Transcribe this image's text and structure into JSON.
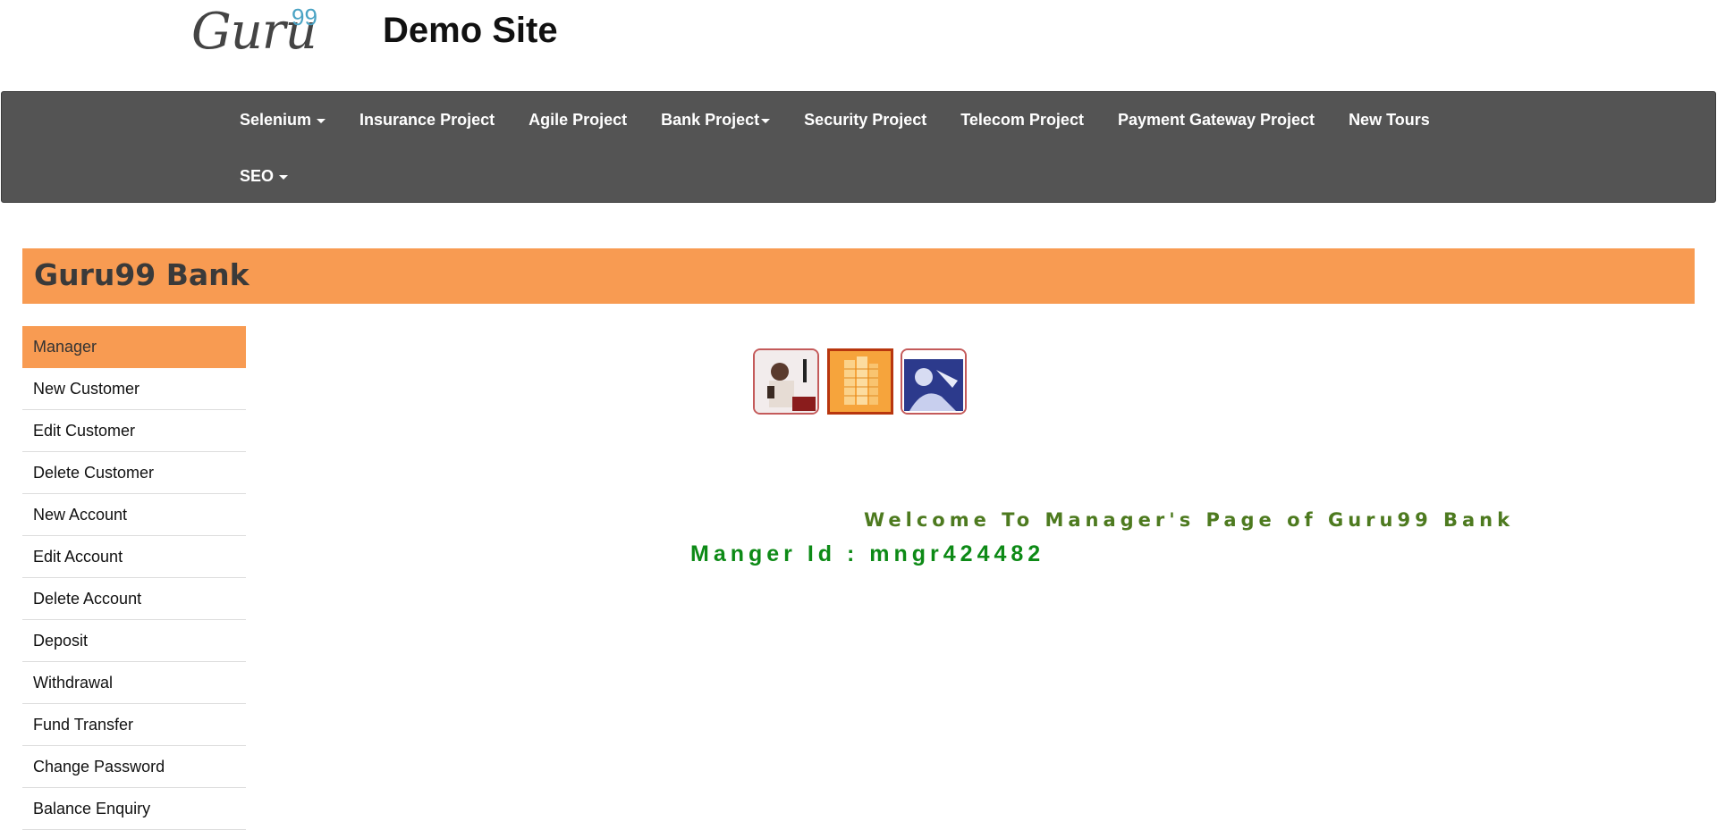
{
  "header": {
    "logo_text": "Guru",
    "logo_sup": "99",
    "site_title": "Demo Site"
  },
  "navbar": {
    "row1": [
      {
        "label": "Selenium",
        "dropdown": true
      },
      {
        "label": "Insurance Project",
        "dropdown": false
      },
      {
        "label": "Agile Project",
        "dropdown": false
      },
      {
        "label": "Bank Project",
        "dropdown": true
      },
      {
        "label": "Security Project",
        "dropdown": false
      },
      {
        "label": "Telecom Project",
        "dropdown": false
      },
      {
        "label": "Payment Gateway Project",
        "dropdown": false
      },
      {
        "label": "New Tours",
        "dropdown": false
      }
    ],
    "row2": [
      {
        "label": "SEO",
        "dropdown": true
      }
    ]
  },
  "banner": {
    "title": "Guru99 Bank"
  },
  "menu": {
    "items": [
      {
        "label": "Manager"
      },
      {
        "label": "New Customer"
      },
      {
        "label": "Edit Customer"
      },
      {
        "label": "Delete Customer"
      },
      {
        "label": "New Account"
      },
      {
        "label": "Edit Account"
      },
      {
        "label": "Delete Account"
      },
      {
        "label": "Deposit"
      },
      {
        "label": "Withdrawal"
      },
      {
        "label": "Fund Transfer"
      },
      {
        "label": "Change Password"
      },
      {
        "label": "Balance Enquiry"
      }
    ]
  },
  "main": {
    "welcome": "Welcome To Manager's Page of Guru99 Bank",
    "manager_id": "Manger Id : mngr424482"
  },
  "colors": {
    "navbar_bg": "#545454",
    "accent_orange": "#f89b52",
    "welcome_green": "#4d7a1f",
    "manager_id_green": "#0d8a16"
  }
}
